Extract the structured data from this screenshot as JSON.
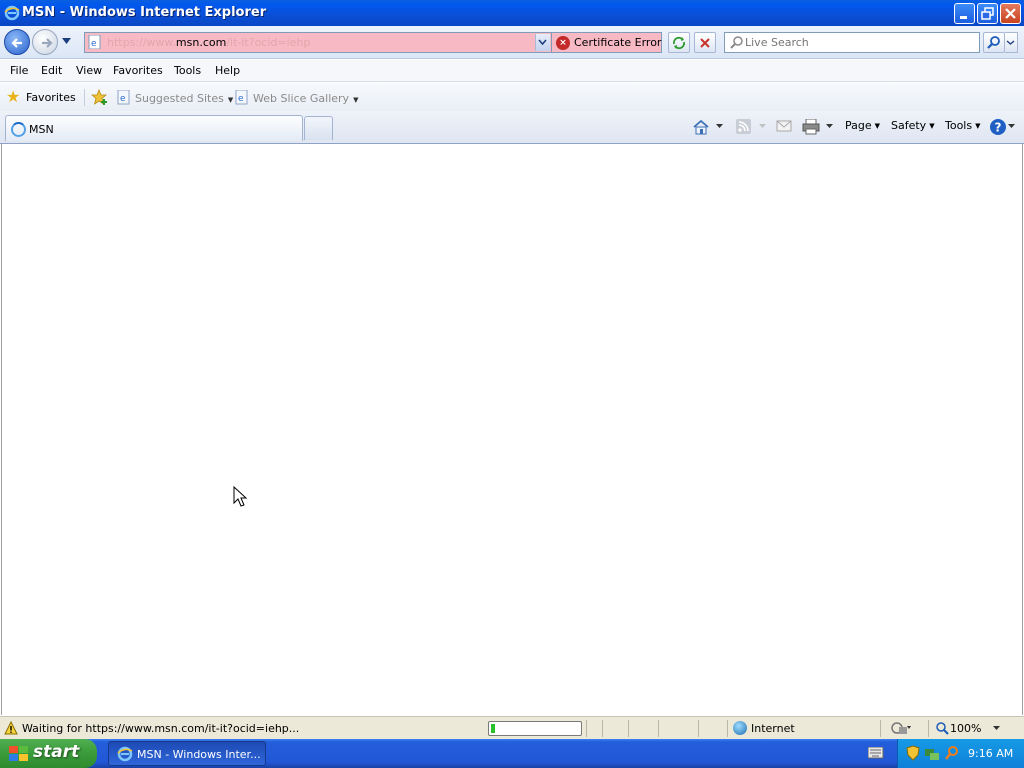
{
  "window": {
    "title": "MSN - Windows Internet Explorer"
  },
  "address": {
    "url_prefix": "https://www.",
    "url_host": "msn.com",
    "url_suffix": "/it-it?ocid=iehp",
    "certificate_error": "Certificate Error"
  },
  "search": {
    "placeholder": "Live Search"
  },
  "menu": {
    "file": "File",
    "edit": "Edit",
    "view": "View",
    "favorites": "Favorites",
    "tools": "Tools",
    "help": "Help"
  },
  "favorites_bar": {
    "favorites": "Favorites",
    "suggested_sites": "Suggested Sites",
    "web_slice_gallery": "Web Slice Gallery"
  },
  "tabs": [
    {
      "label": "MSN"
    }
  ],
  "commands": {
    "page": "Page",
    "safety": "Safety",
    "tools": "Tools"
  },
  "status": {
    "text": "Waiting for https://www.msn.com/it-it?ocid=iehp...",
    "progress_fraction": 0.05,
    "zone": "Internet",
    "zoom": "100%"
  },
  "taskbar": {
    "start": "start",
    "task_label": "MSN - Windows Inter...",
    "clock": "9:16 AM"
  },
  "colors": {
    "titlebar": "#0058ee",
    "cert_error_bg": "#f7b9c3",
    "taskbar": "#245edb",
    "start_button": "#3c9d3c",
    "progress_fill": "#2bbf2b"
  }
}
